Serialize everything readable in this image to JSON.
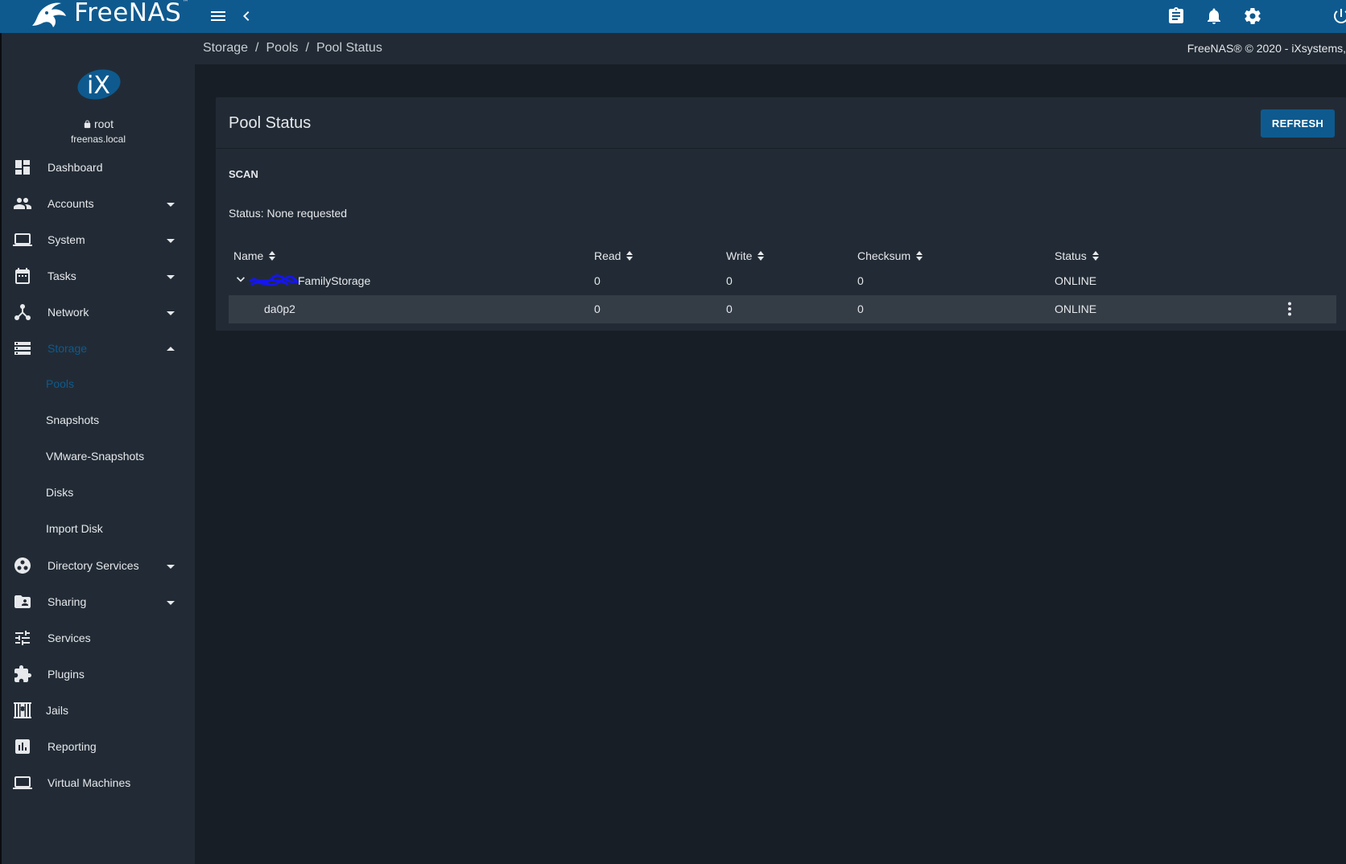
{
  "brand": {
    "name": "FreeNAS",
    "trademark": "™"
  },
  "colors": {
    "primary": "#0e5a8f",
    "sidebar": "#222b35",
    "background": "#181e26",
    "active_nav": "#0e5a8f"
  },
  "topbar": {
    "icons": [
      "menu-icon",
      "chevron-left-icon",
      "clipboard-icon",
      "bell-icon",
      "gear-icon",
      "power-icon"
    ]
  },
  "user": {
    "name": "root",
    "host": "freenas.local",
    "avatar_text": "iX"
  },
  "sidebar": {
    "items": [
      {
        "label": "Dashboard",
        "icon": "dashboard-icon",
        "caret": false
      },
      {
        "label": "Accounts",
        "icon": "people-icon",
        "caret": "down"
      },
      {
        "label": "System",
        "icon": "laptop-icon",
        "caret": "down"
      },
      {
        "label": "Tasks",
        "icon": "calendar-icon",
        "caret": "down"
      },
      {
        "label": "Network",
        "icon": "network-icon",
        "caret": "down"
      },
      {
        "label": "Storage",
        "icon": "storage-icon",
        "caret": "up",
        "active": true
      },
      {
        "label": "Directory Services",
        "icon": "directory-icon",
        "caret": "down"
      },
      {
        "label": "Sharing",
        "icon": "folder-shared-icon",
        "caret": "down"
      },
      {
        "label": "Services",
        "icon": "tune-icon",
        "caret": false
      },
      {
        "label": "Plugins",
        "icon": "puzzle-icon",
        "caret": false
      },
      {
        "label": "Jails",
        "icon": "jail-icon",
        "caret": false
      },
      {
        "label": "Reporting",
        "icon": "chart-icon",
        "caret": false
      },
      {
        "label": "Virtual Machines",
        "icon": "computer-icon",
        "caret": false
      }
    ],
    "storage_sub": [
      {
        "label": "Pools",
        "active": true
      },
      {
        "label": "Snapshots"
      },
      {
        "label": "VMware-Snapshots"
      },
      {
        "label": "Disks"
      },
      {
        "label": "Import Disk"
      }
    ]
  },
  "breadcrumb": [
    "Storage",
    "Pools",
    "Pool Status"
  ],
  "copyright": "FreeNAS® © 2020 - iXsystems,",
  "card": {
    "title": "Pool Status",
    "refresh_label": "REFRESH",
    "scan_title": "SCAN",
    "scan_status": "Status: None requested",
    "columns": [
      "Name",
      "Read",
      "Write",
      "Checksum",
      "Status"
    ],
    "rows": [
      {
        "name": "FamilyStorage",
        "read": "0",
        "write": "0",
        "checksum": "0",
        "status": "ONLINE",
        "expandable": true
      },
      {
        "name": "da0p2",
        "read": "0",
        "write": "0",
        "checksum": "0",
        "status": "ONLINE"
      }
    ]
  }
}
